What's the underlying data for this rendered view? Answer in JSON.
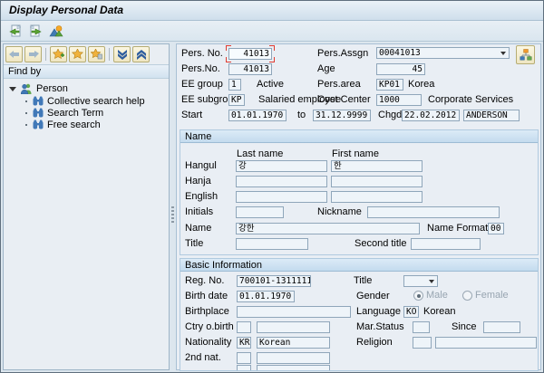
{
  "window": {
    "title": "Display Personal Data"
  },
  "app_toolbar": {
    "icons": [
      "previous-record-icon",
      "next-record-icon",
      "overview-photo-icon"
    ]
  },
  "sidebar": {
    "toolbar_icons": [
      "back-icon",
      "forward-icon",
      "add-favorite-icon",
      "favorites-icon",
      "delete-favorite-icon",
      "collapse-all-icon",
      "expand-all-icon"
    ],
    "header": "Find by",
    "root_node": "Person",
    "items": [
      "Collective search help",
      "Search Term",
      "Free search"
    ]
  },
  "header": {
    "pers_no_label": "Pers. No.",
    "pers_no_value": "41013",
    "pers_assgn_label": "Pers.Assgn",
    "pers_assgn_value": "00041013",
    "pers_no2_label": "Pers.No.",
    "pers_no2_value": "41013",
    "age_label": "Age",
    "age_value": "45",
    "ee_group_label": "EE group",
    "ee_group_value": "1",
    "ee_group_text": "Active",
    "pers_area_label": "Pers.area",
    "pers_area_value": "KP01",
    "pers_area_text": "Korea",
    "ee_subgroup_label": "EE subgroup",
    "ee_subgroup_value": "KP",
    "ee_subgroup_text": "Salaried employee",
    "cost_center_label": "Cost Center",
    "cost_center_value": "1000",
    "cost_center_text": "Corporate Services",
    "start_label": "Start",
    "start_value": "01.01.1970",
    "to_label": "to",
    "end_value": "31.12.9999",
    "chgd_label": "Chgd",
    "chgd_date": "22.02.2012",
    "chgd_by": "ANDERSON"
  },
  "name_section": {
    "title": "Name",
    "col_last": "Last name",
    "col_first": "First name",
    "hangul_label": "Hangul",
    "hangul_last": "강",
    "hangul_first": "한",
    "hanja_label": "Hanja",
    "hanja_last": "",
    "hanja_first": "",
    "english_label": "English",
    "english_last": "",
    "english_first": "",
    "initials_label": "Initials",
    "initials_value": "",
    "nickname_label": "Nickname",
    "nickname_value": "",
    "name_label": "Name",
    "name_value": "강한",
    "name_format_label": "Name Format",
    "name_format_value": "00",
    "title_label": "Title",
    "title_value": "",
    "second_title_label": "Second title",
    "second_title_value": ""
  },
  "basic_section": {
    "title": "Basic Information",
    "reg_no_label": "Reg. No.",
    "reg_no_value": "700101-1311111",
    "title_label": "Title",
    "title_value": "",
    "birth_date_label": "Birth date",
    "birth_date_value": "01.01.1970",
    "gender_label": "Gender",
    "male_label": "Male",
    "female_label": "Female",
    "gender_selected": "Male",
    "birthplace_label": "Birthplace",
    "birthplace_value": "",
    "language_label": "Language",
    "language_value": "KO",
    "language_text": "Korean",
    "ctry_birth_label": "Ctry o.birth",
    "ctry_birth_value": "",
    "ctry_birth_text": "",
    "mar_status_label": "Mar.Status",
    "mar_status_value": "",
    "since_label": "Since",
    "since_value": "",
    "nationality_label": "Nationality",
    "nationality_value": "KR",
    "nationality_text": "Korean",
    "religion_label": "Religion",
    "religion_value": "",
    "religion_text": "",
    "second_nat_label": "2nd nat.",
    "second_nat_value": "",
    "second_nat_text": ""
  },
  "colors": {
    "accent_blue": "#3a6fa8",
    "group_header_from": "#dcebf7",
    "group_header_to": "#c3dbee",
    "field_bg": "#eef4f9",
    "field_border": "#8fa6ba",
    "focus_red": "#e03c31",
    "favorite_star": "#f0a83a"
  }
}
